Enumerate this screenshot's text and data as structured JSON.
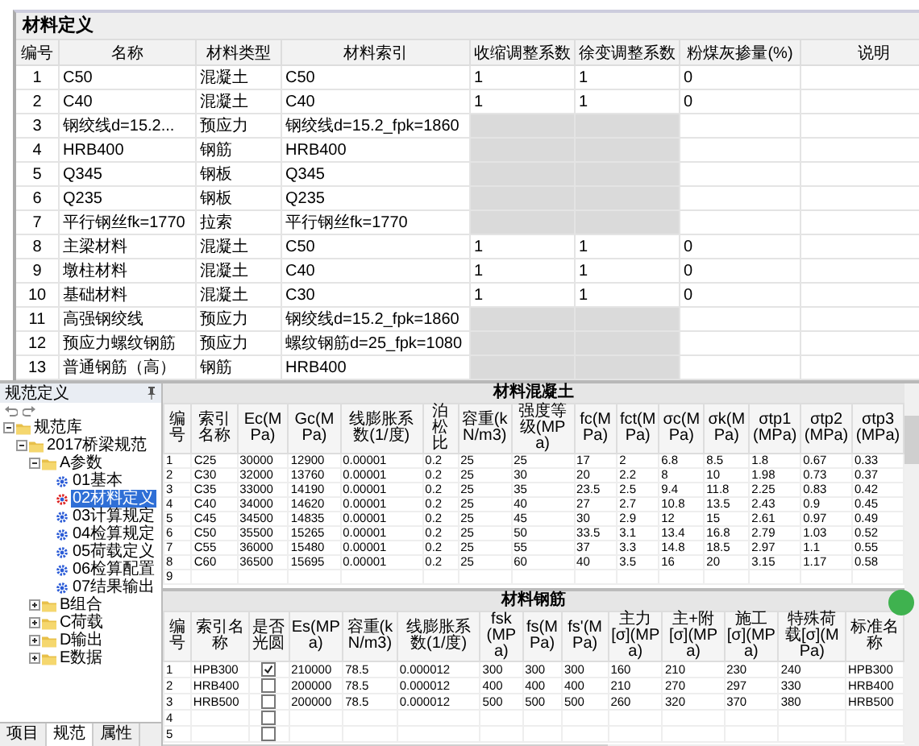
{
  "materials": {
    "title": "材料定义",
    "columns": [
      "编号",
      "名称",
      "材料类型",
      "材料索引",
      "收缩调整系数",
      "徐变调整系数",
      "粉煤灰掺量(%)",
      "说明"
    ],
    "rows": [
      {
        "no": "1",
        "name": "C50",
        "type": "混凝土",
        "index": "C50",
        "applicable": true,
        "shrink": "1",
        "creep": "1",
        "flyash": "0"
      },
      {
        "no": "2",
        "name": "C40",
        "type": "混凝土",
        "index": "C40",
        "applicable": true,
        "shrink": "1",
        "creep": "1",
        "flyash": "0"
      },
      {
        "no": "3",
        "name": "钢绞线d=15.2...",
        "type": "预应力",
        "index": "钢绞线d=15.2_fpk=1860",
        "applicable": false
      },
      {
        "no": "4",
        "name": "HRB400",
        "type": "钢筋",
        "index": "HRB400",
        "applicable": false
      },
      {
        "no": "5",
        "name": "Q345",
        "type": "钢板",
        "index": "Q345",
        "applicable": false
      },
      {
        "no": "6",
        "name": "Q235",
        "type": "钢板",
        "index": "Q235",
        "applicable": false
      },
      {
        "no": "7",
        "name": "平行钢丝fk=1770",
        "type": "拉索",
        "index": "平行钢丝fk=1770",
        "applicable": false
      },
      {
        "no": "8",
        "name": "主梁材料",
        "type": "混凝土",
        "index": "C50",
        "applicable": true,
        "shrink": "1",
        "creep": "1",
        "flyash": "0"
      },
      {
        "no": "9",
        "name": "墩柱材料",
        "type": "混凝土",
        "index": "C40",
        "applicable": true,
        "shrink": "1",
        "creep": "1",
        "flyash": "0"
      },
      {
        "no": "10",
        "name": "基础材料",
        "type": "混凝土",
        "index": "C30",
        "applicable": true,
        "shrink": "1",
        "creep": "1",
        "flyash": "0"
      },
      {
        "no": "11",
        "name": "高强钢绞线",
        "type": "预应力",
        "index": "钢绞线d=15.2_fpk=1860",
        "applicable": false
      },
      {
        "no": "12",
        "name": "预应力螺纹钢筋",
        "type": "预应力",
        "index": "螺纹钢筋d=25_fpk=1080",
        "applicable": false
      },
      {
        "no": "13",
        "name": "普通钢筋（高）",
        "type": "钢筋",
        "index": "HRB400",
        "applicable": false
      }
    ]
  },
  "app": {
    "tree_panel": {
      "title": "规范定义",
      "tree": [
        {
          "label": "规范库",
          "kind": "folder",
          "expanded": true,
          "selected": false,
          "children": [
            {
              "label": "2017桥梁规范",
              "kind": "folder",
              "expanded": true,
              "selected": false,
              "children": [
                {
                  "label": "A参数",
                  "kind": "folder",
                  "expanded": true,
                  "selected": false,
                  "children": [
                    {
                      "label": "01基本",
                      "kind": "item",
                      "selected": false
                    },
                    {
                      "label": "02材料定义",
                      "kind": "item",
                      "selected": true
                    },
                    {
                      "label": "03计算规定",
                      "kind": "item",
                      "selected": false
                    },
                    {
                      "label": "04检算规定",
                      "kind": "item",
                      "selected": false
                    },
                    {
                      "label": "05荷载定义",
                      "kind": "item",
                      "selected": false
                    },
                    {
                      "label": "06检算配置",
                      "kind": "item",
                      "selected": false
                    },
                    {
                      "label": "07结果输出",
                      "kind": "item",
                      "selected": false
                    }
                  ]
                },
                {
                  "label": "B组合",
                  "kind": "folder",
                  "expanded": false,
                  "selected": false
                },
                {
                  "label": "C荷载",
                  "kind": "folder",
                  "expanded": false,
                  "selected": false
                },
                {
                  "label": "D输出",
                  "kind": "folder",
                  "expanded": false,
                  "selected": false
                },
                {
                  "label": "E数据",
                  "kind": "folder",
                  "expanded": false,
                  "selected": false
                }
              ]
            }
          ]
        }
      ],
      "tabs": [
        {
          "label": "项目",
          "selected": false
        },
        {
          "label": "规范",
          "selected": true
        },
        {
          "label": "属性",
          "selected": false
        }
      ]
    },
    "concrete": {
      "title": "材料混凝土",
      "columns": [
        "编号",
        "索引名称",
        "Ec(MPa)",
        "Gc(MPa)",
        "线膨胀系数(1/度)",
        "泊松比",
        "容重(kN/m3)",
        "强度等级(MPa)",
        "fc(MPa)",
        "fct(MPa)",
        "σc(MPa)",
        "σk(MPa)",
        "σtp1(MPa)",
        "σtp2(MPa)",
        "σtp3(MPa)"
      ],
      "rows": [
        [
          "1",
          "C25",
          "30000",
          "12900",
          "0.00001",
          "0.2",
          "25",
          "25",
          "17",
          "2",
          "6.8",
          "8.5",
          "1.8",
          "0.67",
          "0.33"
        ],
        [
          "2",
          "C30",
          "32000",
          "13760",
          "0.00001",
          "0.2",
          "25",
          "30",
          "20",
          "2.2",
          "8",
          "10",
          "1.98",
          "0.73",
          "0.37"
        ],
        [
          "3",
          "C35",
          "33000",
          "14190",
          "0.00001",
          "0.2",
          "25",
          "35",
          "23.5",
          "2.5",
          "9.4",
          "11.8",
          "2.25",
          "0.83",
          "0.42"
        ],
        [
          "4",
          "C40",
          "34000",
          "14620",
          "0.00001",
          "0.2",
          "25",
          "40",
          "27",
          "2.7",
          "10.8",
          "13.5",
          "2.43",
          "0.9",
          "0.45"
        ],
        [
          "5",
          "C45",
          "34500",
          "14835",
          "0.00001",
          "0.2",
          "25",
          "45",
          "30",
          "2.9",
          "12",
          "15",
          "2.61",
          "0.97",
          "0.49"
        ],
        [
          "6",
          "C50",
          "35500",
          "15265",
          "0.00001",
          "0.2",
          "25",
          "50",
          "33.5",
          "3.1",
          "13.4",
          "16.8",
          "2.79",
          "1.03",
          "0.52"
        ],
        [
          "7",
          "C55",
          "36000",
          "15480",
          "0.00001",
          "0.2",
          "25",
          "55",
          "37",
          "3.3",
          "14.8",
          "18.5",
          "2.97",
          "1.1",
          "0.55"
        ],
        [
          "8",
          "C60",
          "36500",
          "15695",
          "0.00001",
          "0.2",
          "25",
          "60",
          "40",
          "3.5",
          "16",
          "20",
          "3.15",
          "1.17",
          "0.58"
        ],
        [
          "9"
        ]
      ]
    },
    "rebar": {
      "title": "材料钢筋",
      "columns": [
        "编号",
        "索引名称",
        "是否光圆",
        "Es(MPa)",
        "容重(kN/m3)",
        "线膨胀系数(1/度)",
        "fsk(MPa)",
        "fs(MPa)",
        "fs'(MPa)",
        "主力[σ](MPa)",
        "主+附[σ](MPa)",
        "施工[σ](MPa)",
        "特殊荷载[σ](MPa)",
        "标准名称"
      ],
      "rows": [
        {
          "no": "1",
          "name": "HPB300",
          "round": true,
          "values": [
            "210000",
            "78.5",
            "0.000012",
            "300",
            "300",
            "300",
            "160",
            "210",
            "230",
            "240",
            "HPB300"
          ]
        },
        {
          "no": "2",
          "name": "HRB400",
          "round": false,
          "values": [
            "200000",
            "78.5",
            "0.000012",
            "400",
            "400",
            "400",
            "210",
            "270",
            "297",
            "330",
            "HRB400"
          ]
        },
        {
          "no": "3",
          "name": "HRB500",
          "round": false,
          "values": [
            "200000",
            "78.5",
            "0.000012",
            "500",
            "500",
            "500",
            "260",
            "320",
            "370",
            "380",
            "HRB500"
          ]
        },
        {
          "no": "4",
          "round": false
        },
        {
          "no": "5",
          "round": false
        }
      ]
    }
  }
}
